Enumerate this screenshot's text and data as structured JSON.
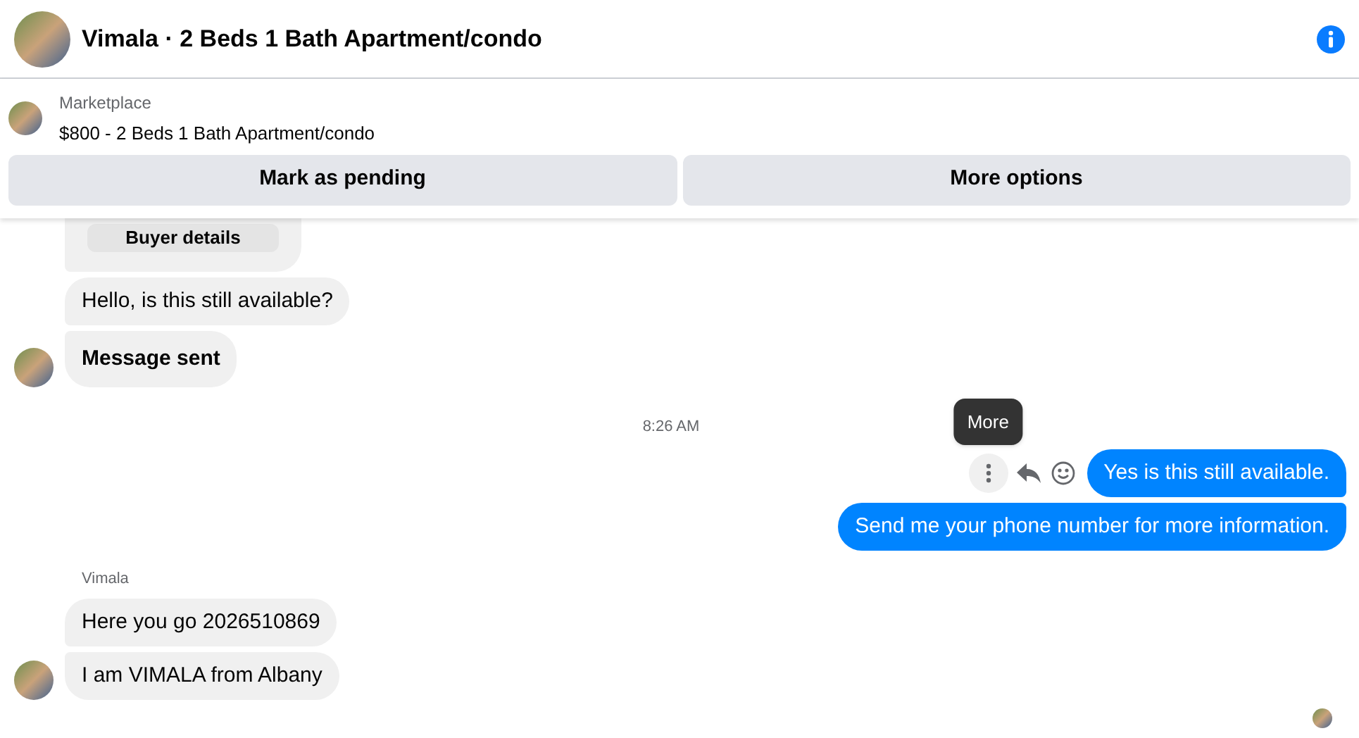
{
  "header": {
    "title": "Vimala · 2 Beds 1 Bath Apartment/condo"
  },
  "listing": {
    "source": "Marketplace",
    "title": "$800 - 2 Beds 1 Bath Apartment/condo"
  },
  "actions": [
    "Mark as pending",
    "More options"
  ],
  "thread": [
    {
      "kind": "incoming_group",
      "card_button": "Buyer details",
      "messages": [
        {
          "text": "Hello, is this still available?",
          "bold": false
        },
        {
          "text": "Message sent",
          "bold": true
        }
      ]
    },
    {
      "kind": "timestamp",
      "text": "8:26 AM"
    },
    {
      "kind": "outgoing_group",
      "tooltip": "More",
      "messages": [
        {
          "text": "Yes is this still available.",
          "hovered": true
        },
        {
          "text": "Send me your phone number for more information.",
          "hovered": false
        }
      ]
    },
    {
      "kind": "incoming_group",
      "sender": "Vimala",
      "messages": [
        {
          "text": "Here you go 2026510869",
          "bold": false
        },
        {
          "text": "I am VIMALA from Albany",
          "bold": false
        }
      ]
    }
  ]
}
